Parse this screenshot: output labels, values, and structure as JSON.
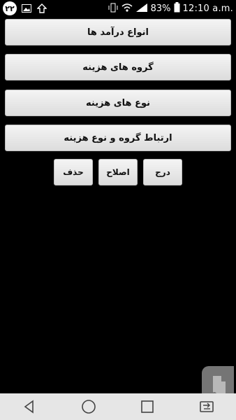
{
  "status_bar": {
    "notification_count": "۲۲",
    "battery_percent": "83%",
    "time": "12:10 a.m.",
    "icons": [
      "notification-badge-icon",
      "image-icon",
      "upload-icon",
      "vibrate-icon",
      "wifi-icon",
      "signal-icon",
      "battery-icon"
    ]
  },
  "menu": {
    "income_types": "انواع درآمد ها",
    "expense_groups": "گروه های هزینه",
    "expense_types": "نوع های هزینه",
    "group_type_link": "ارتباط گروه و نوع هزینه"
  },
  "actions": {
    "insert": "درج",
    "edit": "اصلاح",
    "delete": "حذف"
  },
  "navigation": {
    "icons": [
      "back-icon",
      "home-icon",
      "recents-icon",
      "switch-sim-icon"
    ]
  },
  "colors": {
    "background": "#000000",
    "button_face": "#e8e8e8",
    "nav_bar": "#e6e6e6"
  }
}
